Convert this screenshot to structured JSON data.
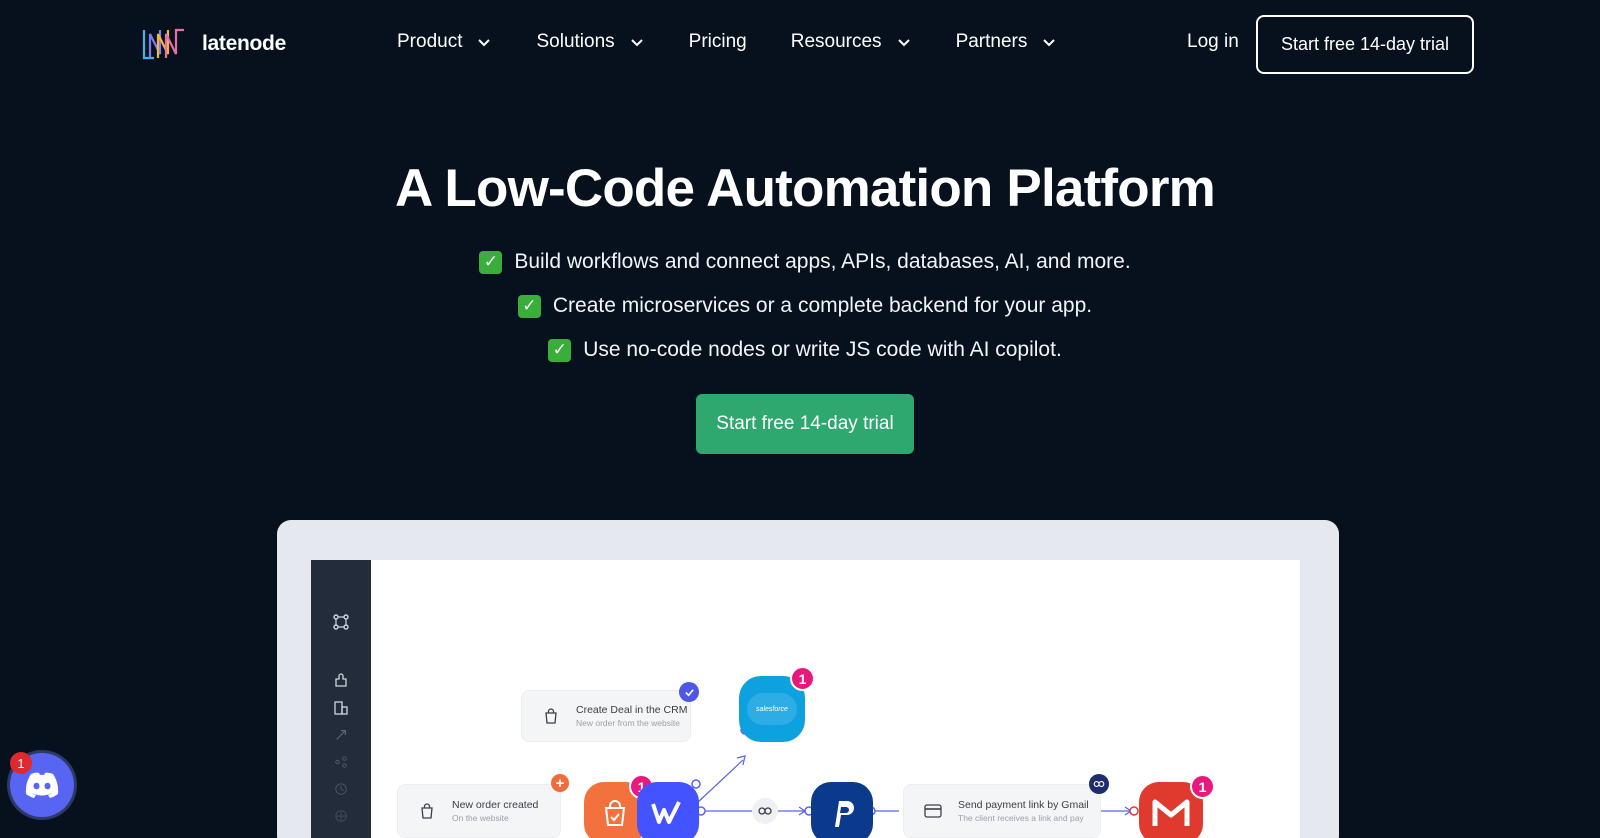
{
  "brand": {
    "name": "latenode"
  },
  "nav": {
    "items": [
      {
        "label": "Product",
        "has_dropdown": true
      },
      {
        "label": "Solutions",
        "has_dropdown": true
      },
      {
        "label": "Pricing",
        "has_dropdown": false
      },
      {
        "label": "Resources",
        "has_dropdown": true
      },
      {
        "label": "Partners",
        "has_dropdown": true
      }
    ],
    "login_label": "Log in",
    "trial_label": "Start free 14-day trial"
  },
  "hero": {
    "title": "A Low-Code Automation Platform",
    "bullets": [
      "Build workflows and connect apps, APIs, databases, AI, and more.",
      "Create microservices or a complete backend for your app.",
      "Use no-code nodes or write JS code with AI copilot."
    ],
    "cta_label": "Start free 14-day trial"
  },
  "workflow": {
    "card_crm": {
      "title": "Create Deal in the CRM",
      "sub": "New order from the website"
    },
    "card_order": {
      "title": "New order created",
      "sub": "On the website"
    },
    "card_payment": {
      "title": "Send payment link by Gmail",
      "sub": "The client receives a link and pay"
    },
    "salesforce_label": "salesforce",
    "badges": {
      "salesforce": "1",
      "shop": "1",
      "gmail": "1"
    }
  },
  "discord": {
    "badge": "1"
  },
  "colors": {
    "background": "#07111d",
    "accent_green": "#2ea86f",
    "badge_pink": "#e8197d",
    "discord": "#5865f2"
  },
  "icons": [
    "chevron-down-icon",
    "check-icon",
    "discord-icon",
    "salesforce-icon",
    "webflow-icon",
    "paypal-icon",
    "gmail-icon",
    "shopping-bag-icon",
    "link-icon"
  ]
}
